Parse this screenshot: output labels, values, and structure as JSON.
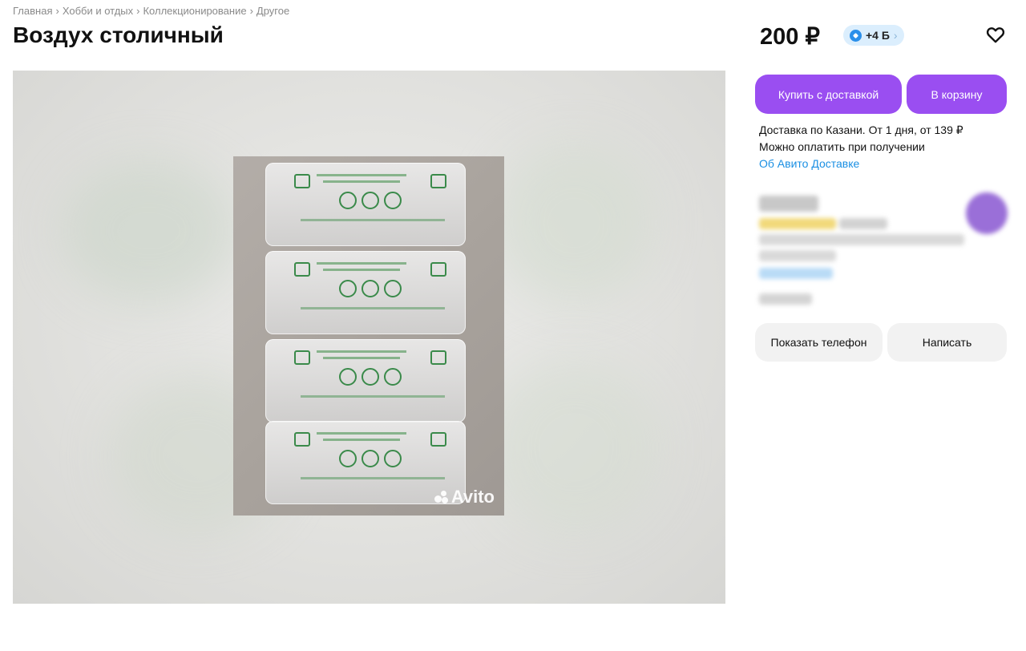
{
  "breadcrumb": [
    "Главная",
    "Хобби и отдых",
    "Коллекционирование",
    "Другое"
  ],
  "breadcrumb_separator": "›",
  "title": "Воздух столичный",
  "price": "200 ₽",
  "bonus": {
    "label": "+4 Б",
    "icon": "bonus-coin-icon",
    "chevron": "›"
  },
  "favorite": {
    "icon": "heart-icon"
  },
  "gallery": {
    "watermark": "Avito"
  },
  "actions": {
    "buy_label": "Купить с доставкой",
    "cart_label": "В корзину"
  },
  "delivery": {
    "line1": "Доставка по Казани. От 1 дня, от 139 ₽",
    "line2": "Можно оплатить при получении",
    "link": "Об Авито Доставке"
  },
  "contact": {
    "phone_label": "Показать телефон",
    "message_label": "Написать"
  },
  "colors": {
    "accent": "#9a4ef1",
    "link": "#1a8fe3",
    "bonus_bg": "#dbeefd"
  }
}
